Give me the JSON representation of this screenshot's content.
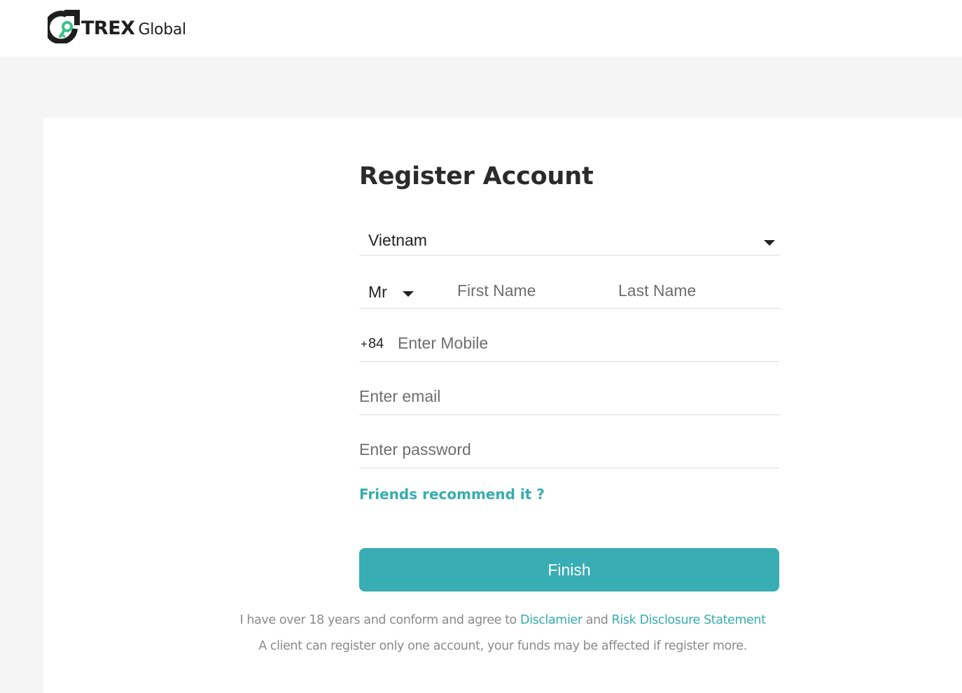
{
  "brand": {
    "name_bold": "TREX",
    "name_light": "Global"
  },
  "form": {
    "title": "Register Account",
    "country": {
      "value": "Vietnam"
    },
    "salutation": {
      "value": "Mr"
    },
    "first_name": {
      "placeholder": "First Name"
    },
    "last_name": {
      "placeholder": "Last Name"
    },
    "mobile": {
      "dial_plus": "+",
      "dial_code": "84",
      "placeholder": "Enter Mobile"
    },
    "email": {
      "placeholder": "Enter email"
    },
    "password": {
      "placeholder": "Enter password"
    },
    "recommend_link": "Friends recommend it ?",
    "submit_label": "Finish"
  },
  "legal": {
    "agree_prefix": "I have over 18 years and conform and agree to ",
    "disclaimer_link": "Disclamier",
    "and_text": " and ",
    "risk_link": "Risk Disclosure Statement",
    "notice": "A client can register only one account, your funds may be affected if register more."
  },
  "colors": {
    "accent": "#38adb3",
    "link": "#36adaf",
    "logo_green": "#3cc08a",
    "page_bg": "#f5f5f5"
  },
  "icons": {
    "logo": "trex-logo-icon",
    "country_dropdown": "chevron-down-icon",
    "salutation_dropdown": "chevron-down-icon"
  }
}
